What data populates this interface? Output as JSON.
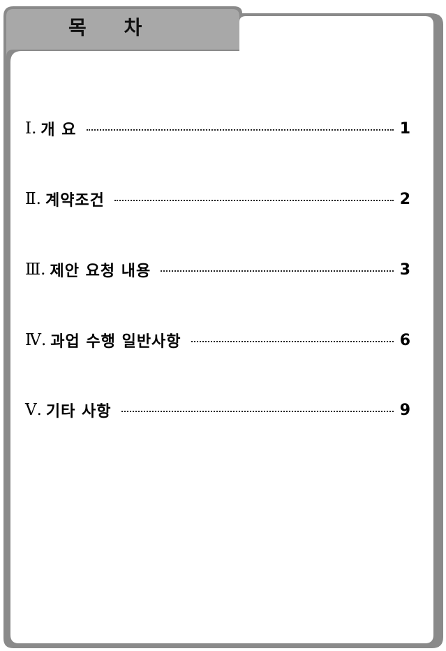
{
  "tab": {
    "label": "목 차"
  },
  "toc": [
    {
      "num": "Ⅰ.",
      "title": "개 요",
      "page": "1"
    },
    {
      "num": "Ⅱ.",
      "title": "계약조건",
      "page": "2"
    },
    {
      "num": "Ⅲ.",
      "title": "제안 요청 내용",
      "page": "3"
    },
    {
      "num": "Ⅳ.",
      "title": "과업 수행 일반사항",
      "page": "6"
    },
    {
      "num": "Ⅴ.",
      "title": "기타 사항",
      "page": "9"
    }
  ]
}
